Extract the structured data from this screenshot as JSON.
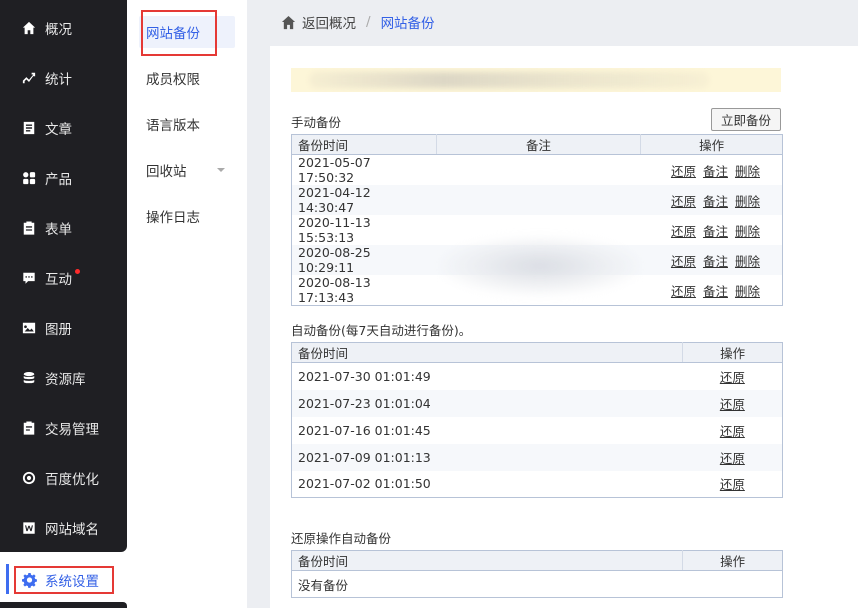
{
  "sidebar": {
    "items": [
      {
        "label": "概况",
        "icon": "home-icon"
      },
      {
        "label": "统计",
        "icon": "chart-icon"
      },
      {
        "label": "文章",
        "icon": "article-icon"
      },
      {
        "label": "产品",
        "icon": "product-icon"
      },
      {
        "label": "表单",
        "icon": "form-icon"
      },
      {
        "label": "互动",
        "icon": "chat-icon"
      },
      {
        "label": "图册",
        "icon": "gallery-icon"
      },
      {
        "label": "资源库",
        "icon": "database-icon"
      },
      {
        "label": "交易管理",
        "icon": "trade-icon"
      },
      {
        "label": "百度优化",
        "icon": "seo-icon"
      },
      {
        "label": "网站域名",
        "icon": "domain-icon"
      }
    ],
    "active": {
      "label": "系统设置",
      "icon": "gear-icon"
    },
    "accent": "#3e6df0"
  },
  "submenu": {
    "items": [
      "网站备份",
      "成员权限",
      "语言版本",
      "回收站",
      "操作日志"
    ]
  },
  "breadcrumb": {
    "back": "返回概况",
    "sep": "/",
    "current": "网站备份"
  },
  "manual": {
    "title": "手动备份",
    "button": "立即备份",
    "headers": [
      "备份时间",
      "备注",
      "操作"
    ],
    "actions": [
      "还原",
      "备注",
      "删除"
    ],
    "rows": [
      {
        "time": "2021-05-07 17:50:32",
        "note": ""
      },
      {
        "time": "2021-04-12 14:30:47",
        "note": ""
      },
      {
        "time": "2020-11-13 15:53:13",
        "note": ""
      },
      {
        "time": "2020-08-25 10:29:11",
        "note": ""
      },
      {
        "time": "2020-08-13 17:13:43",
        "note": ""
      }
    ]
  },
  "auto": {
    "title": "自动备份(每7天自动进行备份)。",
    "headers": [
      "备份时间",
      "操作"
    ],
    "action": "还原",
    "rows": [
      {
        "time": "2021-07-30 01:01:49"
      },
      {
        "time": "2021-07-23 01:01:04"
      },
      {
        "time": "2021-07-16 01:01:45"
      },
      {
        "time": "2021-07-09 01:01:13"
      },
      {
        "time": "2021-07-02 01:01:50"
      }
    ]
  },
  "restore": {
    "title": "还原操作自动备份",
    "headers": [
      "备份时间",
      "操作"
    ],
    "empty": "没有备份"
  }
}
